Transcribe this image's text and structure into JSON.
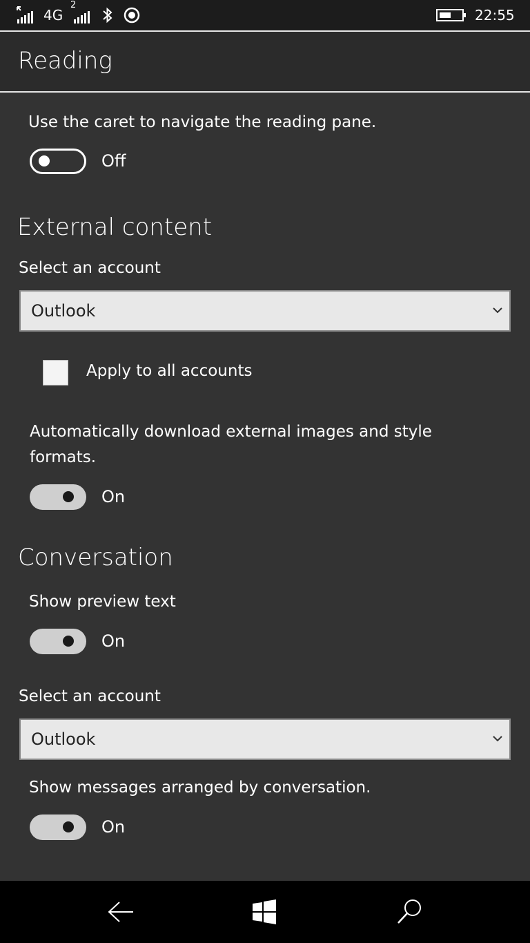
{
  "status_bar": {
    "signal1_icon": "cellular-signal-icon",
    "network": "4G",
    "sim2_marker": "2",
    "signal2_icon": "cellular-signal-icon",
    "bluetooth_icon": "bluetooth-icon",
    "location_icon": "location-icon",
    "battery_icon": "battery-icon",
    "time": "22:55"
  },
  "header": {
    "title": "Reading"
  },
  "caret": {
    "label": "Use the caret to navigate the reading pane.",
    "toggle_state": "Off"
  },
  "external_content": {
    "title": "External content",
    "select_label": "Select an account",
    "selected_account": "Outlook",
    "apply_all_label": "Apply to all accounts",
    "apply_all_checked": false,
    "download_label_line1": "Automatically download external images and style",
    "download_label_line2": "formats.",
    "download_state": "On"
  },
  "conversation": {
    "title": "Conversation",
    "preview_label": "Show preview text",
    "preview_state": "On",
    "select_label": "Select an account",
    "selected_account": "Outlook",
    "arranged_label": "Show messages arranged by conversation.",
    "arranged_state": "On"
  },
  "colors": {
    "background": "#333333",
    "header_bg": "#2b2b2b",
    "nav_bg": "#000000",
    "toggle_on": "#cfcfcf"
  },
  "nav_bar": {
    "back_icon": "back-arrow-icon",
    "home_icon": "windows-logo-icon",
    "search_icon": "search-icon"
  }
}
